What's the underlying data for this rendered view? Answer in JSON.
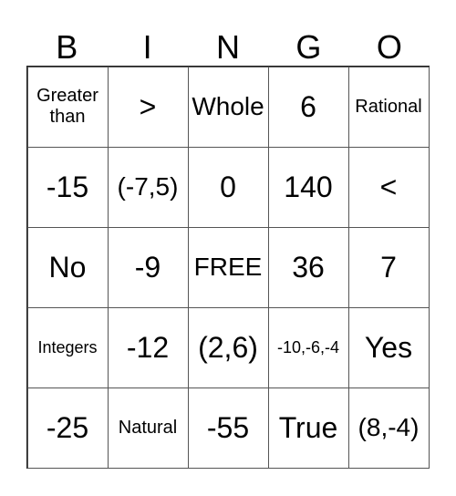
{
  "header": [
    "B",
    "I",
    "N",
    "G",
    "O"
  ],
  "cells": [
    {
      "text": "Greater than",
      "size": "s-s"
    },
    {
      "text": ">",
      "size": "s-xl"
    },
    {
      "text": "Whole",
      "size": "s-l"
    },
    {
      "text": "6",
      "size": "s-xl"
    },
    {
      "text": "Rational",
      "size": "s-s"
    },
    {
      "text": "-15",
      "size": "s-xl"
    },
    {
      "text": "(-7,5)",
      "size": "s-l"
    },
    {
      "text": "0",
      "size": "s-xl"
    },
    {
      "text": "140",
      "size": "s-xl"
    },
    {
      "text": "<",
      "size": "s-xl"
    },
    {
      "text": "No",
      "size": "s-xl"
    },
    {
      "text": "-9",
      "size": "s-xl"
    },
    {
      "text": "FREE",
      "size": "s-l"
    },
    {
      "text": "36",
      "size": "s-xl"
    },
    {
      "text": "7",
      "size": "s-xl"
    },
    {
      "text": "Integers",
      "size": "s-xs"
    },
    {
      "text": "-12",
      "size": "s-xl"
    },
    {
      "text": "(2,6)",
      "size": "s-xl"
    },
    {
      "text": "-10,-6,-4",
      "size": "s-xs"
    },
    {
      "text": "Yes",
      "size": "s-xl"
    },
    {
      "text": "-25",
      "size": "s-xl"
    },
    {
      "text": "Natural",
      "size": "s-s"
    },
    {
      "text": "-55",
      "size": "s-xl"
    },
    {
      "text": "True",
      "size": "s-xl"
    },
    {
      "text": "(8,-4)",
      "size": "s-l"
    }
  ]
}
